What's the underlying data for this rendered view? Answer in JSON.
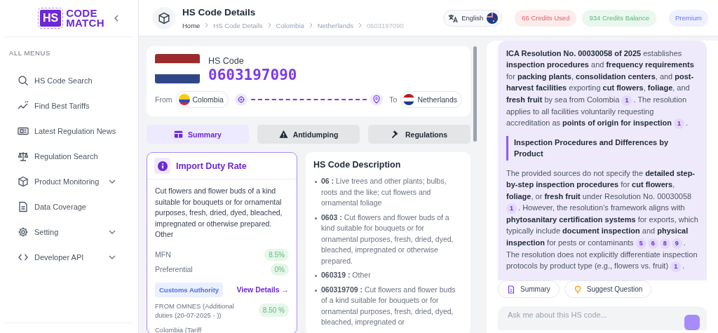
{
  "sidebar": {
    "logo": {
      "mark": "HS",
      "line1": "CODE",
      "line2": "MATCH"
    },
    "section_label": "ALL MENUS",
    "items": [
      {
        "label": "HS Code Search",
        "expandable": false
      },
      {
        "label": "Find Best Tariffs",
        "expandable": false
      },
      {
        "label": "Latest Regulation News",
        "expandable": false
      },
      {
        "label": "Regulation Search",
        "expandable": false
      },
      {
        "label": "Product Monitoring",
        "expandable": true
      },
      {
        "label": "Data Coverage",
        "expandable": false
      },
      {
        "label": "Setting",
        "expandable": true
      },
      {
        "label": "Developer API",
        "expandable": true
      }
    ]
  },
  "header": {
    "title": "HS Code Details",
    "breadcrumbs": [
      "Home",
      "HS Code Details",
      "Colombia",
      "Netherlands",
      "0603197090"
    ],
    "language": "English",
    "credits_used": "66 Credits Used",
    "credits_balance": "934 Credits Balance",
    "plan": "Premium"
  },
  "hs_card": {
    "label": "HS Code",
    "code": "0603197090",
    "from_label": "From",
    "from": "Colombia",
    "to_label": "To",
    "to": "Netherlands"
  },
  "tabs": [
    {
      "label": "Summary",
      "selected": true
    },
    {
      "label": "Antidumping",
      "selected": false
    },
    {
      "label": "Regulations",
      "selected": false
    }
  ],
  "duty_card": {
    "title": "Import Duty Rate",
    "description": "Cut flowers and flower buds of a kind suitable for bouquets or for ornamental purposes, fresh, dried, dyed, bleached, impregnated or otherwise prepared. Other",
    "rates": [
      {
        "label": "MFN",
        "value": "8.5%"
      },
      {
        "label": "Preferential",
        "value": "0%"
      }
    ],
    "authority": "Customs Authority",
    "view_details": "View Details →",
    "extra_rates": [
      {
        "label": "FROM OMNES (Additional duties (20-07-2025 - ))",
        "value": "8.50 %"
      },
      {
        "label": "Colombia (Tariff"
      }
    ]
  },
  "description_card": {
    "title": "HS Code Description",
    "items": [
      {
        "code": "06 :",
        "text": "Live trees and other plants; bulbs, roots and the like; cut flowers and ornamental foliage"
      },
      {
        "code": "0603 :",
        "text": "Cut flowers and flower buds of a kind suitable for bouquets or for ornamental purposes, fresh, dried, dyed, bleached, impregnated or otherwise prepared."
      },
      {
        "code": "060319 :",
        "text": "Other"
      },
      {
        "code": "060319709 :",
        "text": "Cut flowers and flower buds of a kind suitable for bouquets or for ornamental purposes, fresh, dried, dyed, bleached, impregnated or"
      }
    ]
  },
  "chat": {
    "blocks": [
      {
        "kind": "paragraph",
        "segments": [
          {
            "text": "**ICA Resolution No. 00030058 of 2025** establishes **inspection procedures** and **frequency requirements** for **packing plants**, **consolidation centers**, and **post-harvest facilities** exporting **cut flowers**, **foliage**, and **fresh fruit** by sea from Colombia "
          },
          {
            "cite": "1"
          },
          {
            "text": ". The resolution applies to all facilities voluntarily requesting accreditation as **points of origin for inspection** "
          },
          {
            "cite": "1"
          },
          {
            "text": "."
          }
        ]
      },
      {
        "kind": "heading",
        "segments": [
          {
            "text": "Inspection Procedures and Differences by Product"
          }
        ]
      },
      {
        "kind": "paragraph",
        "segments": [
          {
            "text": "The provided sources do not specify the **detailed step-by-step inspection procedures** for **cut flowers**, **foliage**, or **fresh fruit** under Resolution No. 00030058 "
          },
          {
            "cite": "1"
          },
          {
            "text": ". However, the resolution’s framework aligns with **phytosanitary certification systems** for exports, which typically include **document inspection** and **physical inspection** for pests or contaminants "
          },
          {
            "cite": "5"
          },
          {
            "cite": "6"
          },
          {
            "cite": "8"
          },
          {
            "cite": "9"
          },
          {
            "text": ". The resolution does not explicitly differentiate inspection protocols by product type (e.g., flowers vs. fruit) "
          },
          {
            "cite": "1"
          },
          {
            "text": "."
          }
        ]
      }
    ],
    "actions": [
      "Summary",
      "Suggest Question"
    ],
    "input": {
      "placeholder": "Ask me about this HS code..."
    }
  }
}
